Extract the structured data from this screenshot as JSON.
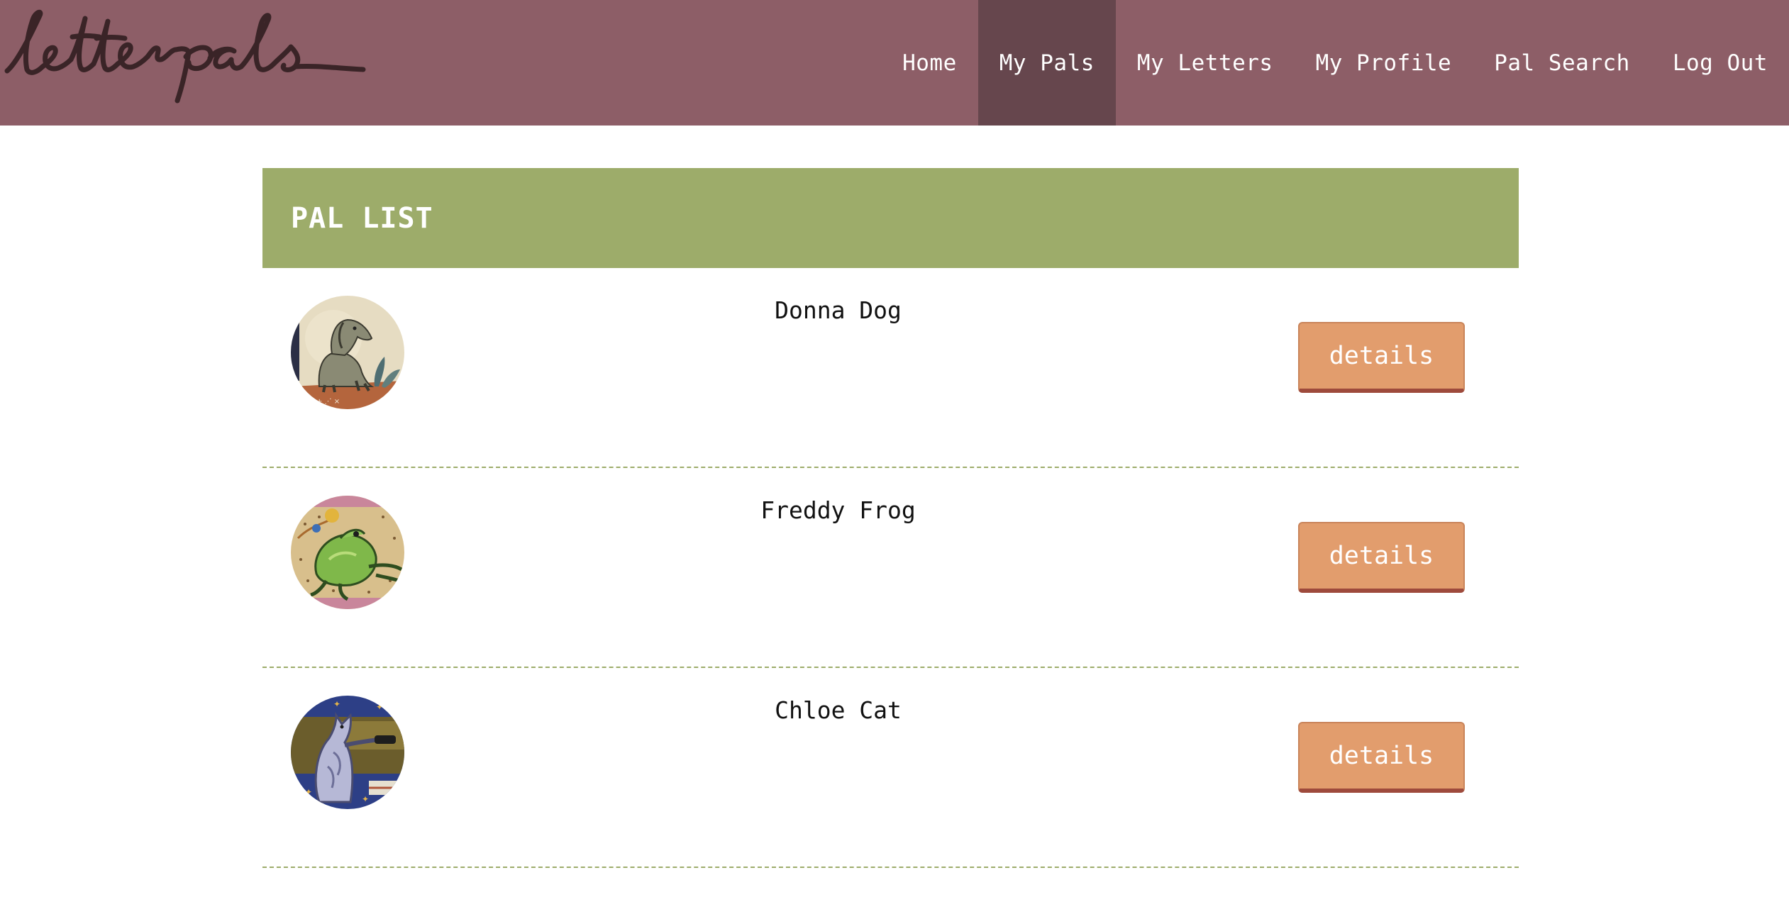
{
  "logo": {
    "text": "letterpals",
    "color": "#3a2427"
  },
  "nav": {
    "items": [
      {
        "label": "Home"
      },
      {
        "label": "My Pals",
        "active": true
      },
      {
        "label": "My Letters"
      },
      {
        "label": "My Profile"
      },
      {
        "label": "Pal Search"
      },
      {
        "label": "Log Out"
      }
    ]
  },
  "pal_list": {
    "title": "PAL LIST",
    "pals": [
      {
        "name": "Donna Dog",
        "avatar_icon": "dog-avatar-icon",
        "button_label": "details"
      },
      {
        "name": "Freddy Frog",
        "avatar_icon": "frog-avatar-icon",
        "button_label": "details"
      },
      {
        "name": "Chloe Cat",
        "avatar_icon": "cat-avatar-icon",
        "button_label": "details"
      }
    ]
  },
  "colors": {
    "header_bg": "#8d5e67",
    "nav_active_bg": "#66464d",
    "card_header_bg": "#9dac6a",
    "button_bg": "#e29d6d",
    "button_shadow": "#9e4a3c"
  }
}
